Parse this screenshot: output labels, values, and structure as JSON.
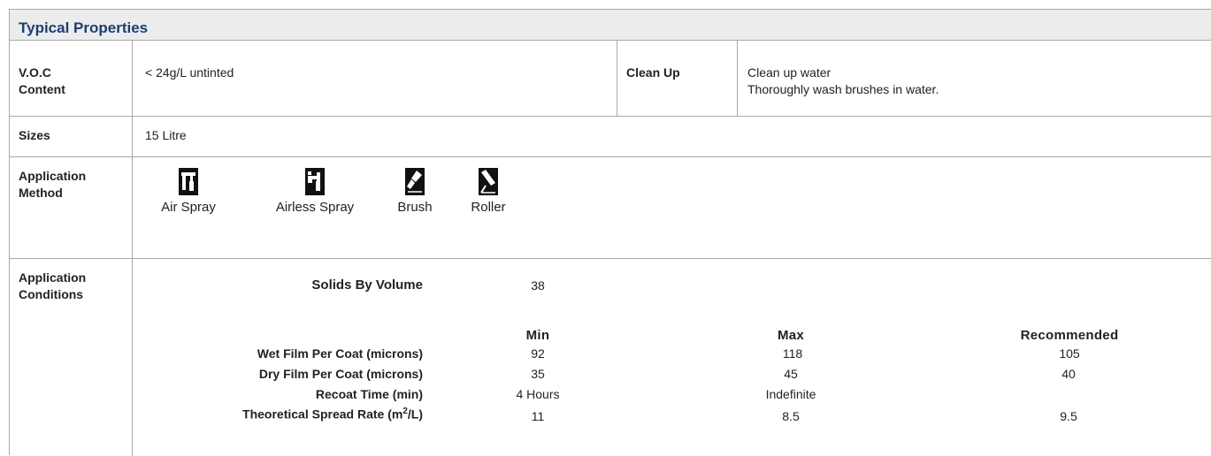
{
  "title": "Typical Properties",
  "voc": {
    "label_line1": "V.O.C",
    "label_line2": "Content",
    "value": "< 24g/L untinted"
  },
  "cleanup": {
    "label": "Clean Up",
    "line1": "Clean up water",
    "line2": "Thoroughly wash brushes in water."
  },
  "sizes": {
    "label": "Sizes",
    "value": "15 Litre"
  },
  "application_method": {
    "label_line1": "Application",
    "label_line2": "Method",
    "methods": [
      {
        "icon": "air-spray-icon",
        "label": "Air Spray"
      },
      {
        "icon": "airless-spray-icon",
        "label": "Airless Spray"
      },
      {
        "icon": "brush-icon",
        "label": "Brush"
      },
      {
        "icon": "roller-icon",
        "label": "Roller"
      }
    ]
  },
  "application_conditions": {
    "label_line1": "Application",
    "label_line2": "Conditions",
    "solids_label": "Solids By Volume",
    "solids_value": "38",
    "columns": [
      "Min",
      "Max",
      "Recommended"
    ],
    "rows": [
      {
        "label": "Wet Film Per Coat (microns)",
        "min": "92",
        "max": "118",
        "rec": "105"
      },
      {
        "label": "Dry Film Per Coat (microns)",
        "min": "35",
        "max": "45",
        "rec": "40"
      },
      {
        "label": "Recoat Time (min)",
        "min": "4 Hours",
        "max": "Indefinite",
        "rec": ""
      }
    ],
    "spread": {
      "label_pre": "Theoretical Spread Rate (m",
      "label_sup": "2",
      "label_post": "/L)",
      "min": "11",
      "max": "8.5",
      "rec": "9.5"
    }
  }
}
